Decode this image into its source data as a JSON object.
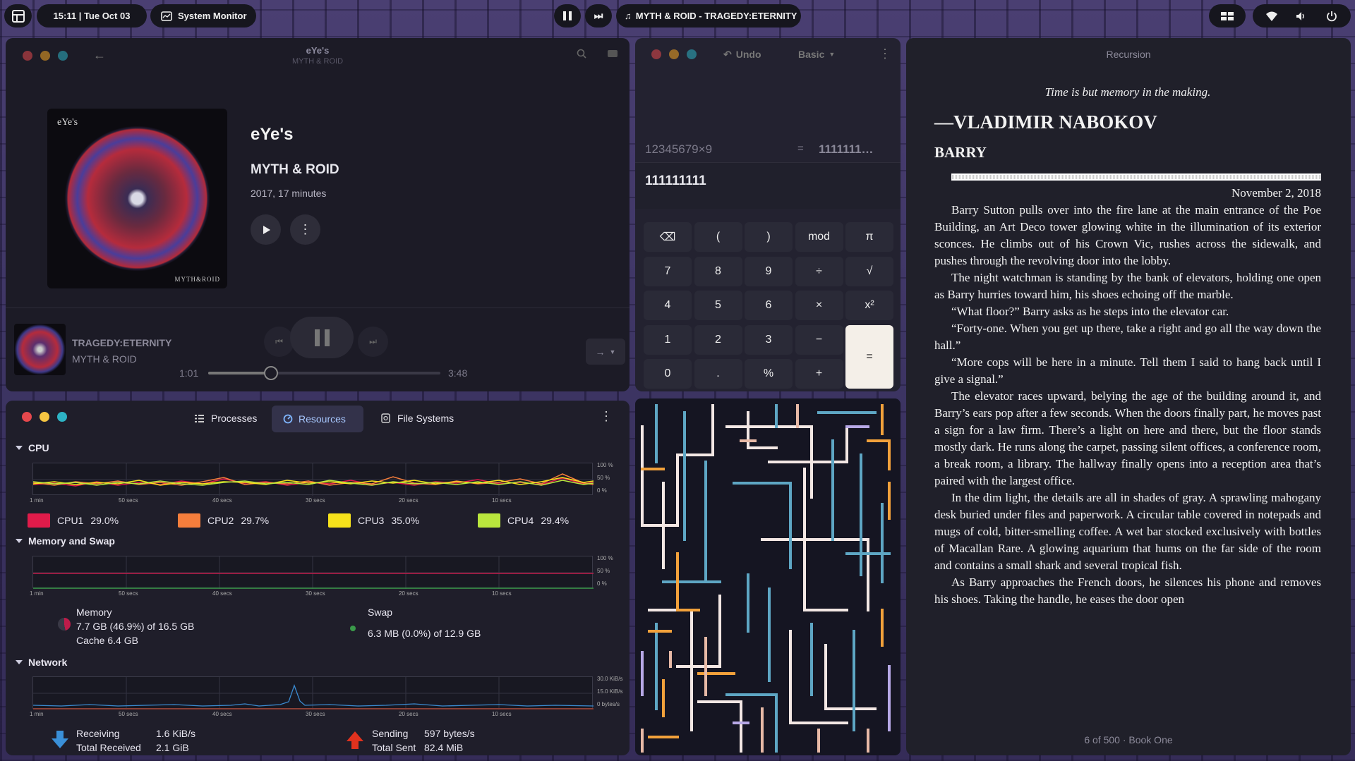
{
  "topbar": {
    "clock": "15:11 | Tue Oct 03",
    "app": "System Monitor",
    "now_playing": "MYTH & ROID - TRAGEDY:ETERNITY"
  },
  "music": {
    "title": "eYe's",
    "subtitle": "MYTH & ROID",
    "album_title": "eYe's",
    "artist": "MYTH & ROID",
    "meta": "2017, 17 minutes",
    "cover_text_top": "eYe's",
    "cover_text_bottom": "MYTH&ROID",
    "track_title": "TRAGEDY:ETERNITY",
    "track_artist": "MYTH & ROID",
    "elapsed": "1:01",
    "duration": "3:48",
    "progress_fraction": 0.27
  },
  "sysmon": {
    "tabs": [
      "Processes",
      "Resources",
      "File Systems"
    ],
    "cpu_section": "CPU",
    "mem_section": "Memory and Swap",
    "net_section": "Network",
    "pct_ticks": [
      "100 %",
      "50 %",
      "0 %"
    ],
    "net_ticks": [
      "30.0 KiB/s",
      "15.0 KiB/s",
      "0 bytes/s"
    ],
    "time_ticks": [
      "1 min",
      "50 secs",
      "40 secs",
      "30 secs",
      "20 secs",
      "10 secs"
    ],
    "cpus": [
      {
        "name": "CPU1",
        "value": "29.0%",
        "color": "#e01b4a"
      },
      {
        "name": "CPU2",
        "value": "29.7%",
        "color": "#f57e3c"
      },
      {
        "name": "CPU3",
        "value": "35.0%",
        "color": "#f6e21b"
      },
      {
        "name": "CPU4",
        "value": "29.4%",
        "color": "#b9e63d"
      }
    ],
    "memory": {
      "label": "Memory",
      "usage": "7.7 GB (46.9%) of 16.5 GB",
      "cache": "Cache 6.4 GB"
    },
    "swap": {
      "label": "Swap",
      "usage": "6.3 MB (0.0%) of 12.9 GB"
    },
    "network": {
      "receiving_label": "Receiving",
      "receiving": "1.6 KiB/s",
      "total_received_label": "Total Received",
      "total_received": "2.1 GiB",
      "sending_label": "Sending",
      "sending": "597 bytes/s",
      "total_sent_label": "Total Sent",
      "total_sent": "82.4 MiB"
    }
  },
  "calculator": {
    "undo": "Undo",
    "mode": "Basic",
    "expression": "12345679×9",
    "equals": "=",
    "result_preview": "1111111…",
    "input": "111111111",
    "keys": [
      [
        "⌫",
        "(",
        ")",
        "mod",
        "π"
      ],
      [
        "7",
        "8",
        "9",
        "÷",
        "√"
      ],
      [
        "4",
        "5",
        "6",
        "×",
        "x²"
      ],
      [
        "1",
        "2",
        "3",
        "−",
        "="
      ],
      [
        "0",
        ".",
        "%",
        "+"
      ]
    ]
  },
  "book": {
    "header": "Recursion",
    "epigraph": "Time is but memory in the making.",
    "author": "—VLADIMIR NABOKOV",
    "chapter": "BARRY",
    "date": "November 2, 2018",
    "paragraphs": [
      "Barry Sutton pulls over into the fire lane at the main entrance of the Poe Building, an Art Deco tower glowing white in the illumination of its exterior sconces. He climbs out of his Crown Vic, rushes across the sidewalk, and pushes through the revolving door into the lobby.",
      "The night watchman is standing by the bank of elevators, holding one open as Barry hurries toward him, his shoes echoing off the marble.",
      "“What floor?” Barry asks as he steps into the elevator car.",
      "“Forty-one. When you get up there, take a right and go all the way down the hall.”",
      "“More cops will be here in a minute. Tell them I said to hang back until I give a signal.”",
      "The elevator races upward, belying the age of the building around it, and Barry’s ears pop after a few seconds. When the doors finally part, he moves past a sign for a law firm. There’s a light on here and there, but the floor stands mostly dark. He runs along the carpet, passing silent offices, a conference room, a break room, a library. The hallway finally opens into a reception area that’s paired with the largest office.",
      "In the dim light, the details are all in shades of gray. A sprawling mahogany desk buried under files and paperwork. A circular table covered in notepads and mugs of cold, bitter-smelling coffee. A wet bar stocked exclusively with bottles of Macallan Rare. A glowing aquarium that hums on the far side of the room and contains a small shark and several tropical fish.",
      "As Barry approaches the French doors, he silences his phone and removes his shoes. Taking the handle, he eases the door open"
    ],
    "footer": "6 of 500 · Book One"
  }
}
